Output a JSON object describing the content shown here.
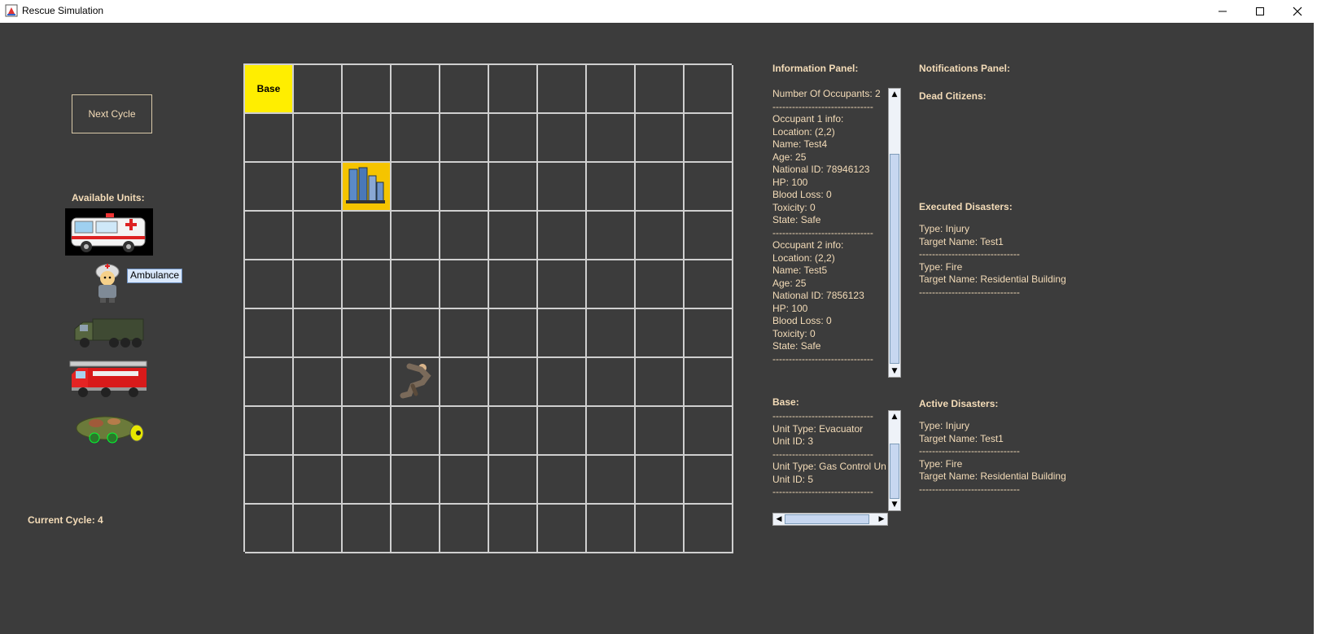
{
  "window": {
    "title": "Rescue Simulation"
  },
  "controls": {
    "next_cycle_label": "Next Cycle",
    "available_units_label": "Available Units:",
    "current_cycle_label": "Current Cycle: 4",
    "units": [
      {
        "name": "ambulance",
        "icon": "ambulance-icon"
      },
      {
        "name": "disease-control-unit",
        "icon": "medic-icon",
        "tooltip": "Ambulance"
      },
      {
        "name": "evacuator",
        "icon": "army-truck-icon"
      },
      {
        "name": "fire-truck",
        "icon": "fire-truck-icon"
      },
      {
        "name": "gas-control-unit",
        "icon": "gas-control-icon"
      }
    ]
  },
  "grid": {
    "rows": 10,
    "cols": 10,
    "base_label": "Base"
  },
  "info_panel": {
    "title": "Information Panel:",
    "lines": [
      "Number Of Occupants: 2",
      "-------------------------------",
      "Occupant 1 info:",
      "Location: (2,2)",
      "Name: Test4",
      "Age: 25",
      "National ID: 78946123",
      "HP: 100",
      "Blood Loss: 0",
      "Toxicity: 0",
      "State: Safe",
      "-------------------------------",
      "Occupant 2 info:",
      "Location: (2,2)",
      "Name: Test5",
      "Age: 25",
      "National ID: 7856123",
      "HP: 100",
      "Blood Loss: 0",
      "Toxicity: 0",
      "State: Safe",
      "-------------------------------"
    ]
  },
  "base_panel": {
    "title": "Base:",
    "lines": [
      "-------------------------------",
      "Unit Type: Evacuator",
      "Unit ID: 3",
      "-------------------------------",
      "Unit Type: Gas Control Unit",
      "Unit ID: 5",
      "-------------------------------"
    ]
  },
  "notifications": {
    "title": "Notifications Panel:",
    "dead_citizens_title": "Dead Citizens:",
    "executed_title": "Executed Disasters:",
    "executed_lines": [
      "Type: Injury",
      "Target Name: Test1",
      "-------------------------------",
      "Type: Fire",
      "Target Name: Residential Building",
      "-------------------------------"
    ],
    "active_title": "Active Disasters:",
    "active_lines": [
      "Type: Injury",
      "Target Name: Test1",
      "-------------------------------",
      "Type: Fire",
      "Target Name: Residential Building",
      "-------------------------------"
    ]
  },
  "colors": {
    "background": "#3c3c3c",
    "text": "#f4dcb8",
    "base_cell": "#ffee00",
    "building_cell": "#f5c400",
    "grid_line": "#cfcfcf"
  }
}
